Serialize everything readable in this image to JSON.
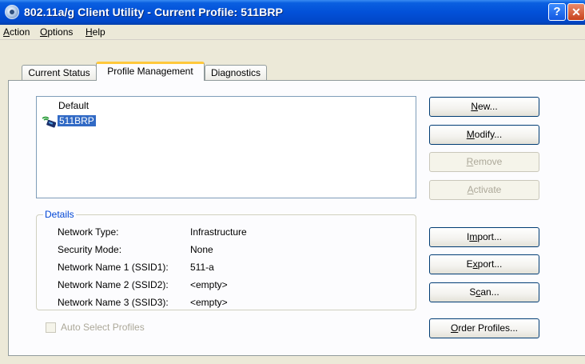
{
  "window": {
    "title": "802.11a/g Client Utility - Current Profile: 511BRP",
    "help_glyph": "?",
    "close_glyph": "✕"
  },
  "menu": [
    "Action",
    "Options",
    "Help"
  ],
  "tabs": [
    {
      "label": "Current Status",
      "active": false
    },
    {
      "label": "Profile Management",
      "active": true
    },
    {
      "label": "Diagnostics",
      "active": false
    }
  ],
  "profiles": [
    {
      "name": "Default",
      "selected": false,
      "icon": "wireless-signal-icon"
    },
    {
      "name": "511BRP",
      "selected": true,
      "icon": "wireless-signal-icon"
    }
  ],
  "buttons": {
    "new": "New...",
    "modify": "Modify...",
    "remove": "Remove",
    "activate": "Activate",
    "import": "Import...",
    "export": "Export...",
    "scan": "Scan...",
    "order_profiles": "Order Profiles..."
  },
  "details": {
    "title": "Details",
    "rows": [
      {
        "label": "Network Type:",
        "value": "Infrastructure"
      },
      {
        "label": "Security Mode:",
        "value": "None"
      },
      {
        "label": "Network Name 1 (SSID1):",
        "value": "511-a"
      },
      {
        "label": "Network Name 2 (SSID2):",
        "value": "<empty>"
      },
      {
        "label": "Network Name 3 (SSID3):",
        "value": "<empty>"
      }
    ]
  },
  "auto_select": {
    "label": "Auto Select Profiles",
    "checked": false,
    "enabled": false
  },
  "colors": {
    "titlebar": "#0250d8",
    "selection": "#316ac5",
    "active_tab_accent": "#ffc83c",
    "group_title": "#0046d5"
  }
}
